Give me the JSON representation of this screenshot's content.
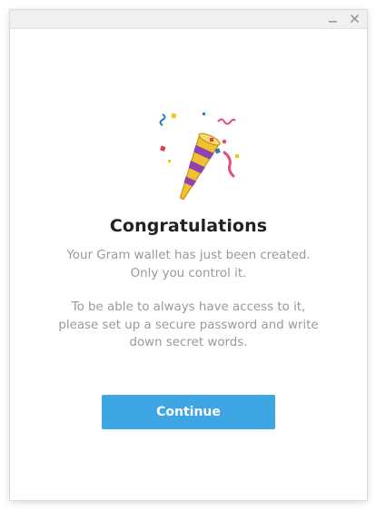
{
  "window": {
    "accent_color": "#3ea6e3"
  },
  "titlebar": {
    "minimize_icon": "minimize-icon",
    "close_icon": "close-icon"
  },
  "illustration": {
    "icon": "party-popper-icon"
  },
  "main": {
    "title": "Congratulations",
    "paragraph1": {
      "line1": "Your Gram wallet has just been created.",
      "line2": "Only you control it."
    },
    "paragraph2": {
      "line1": "To be able to always have access to it,",
      "line2": "please set up a secure password and write",
      "line3": "down secret words."
    },
    "continue_label": "Continue"
  }
}
